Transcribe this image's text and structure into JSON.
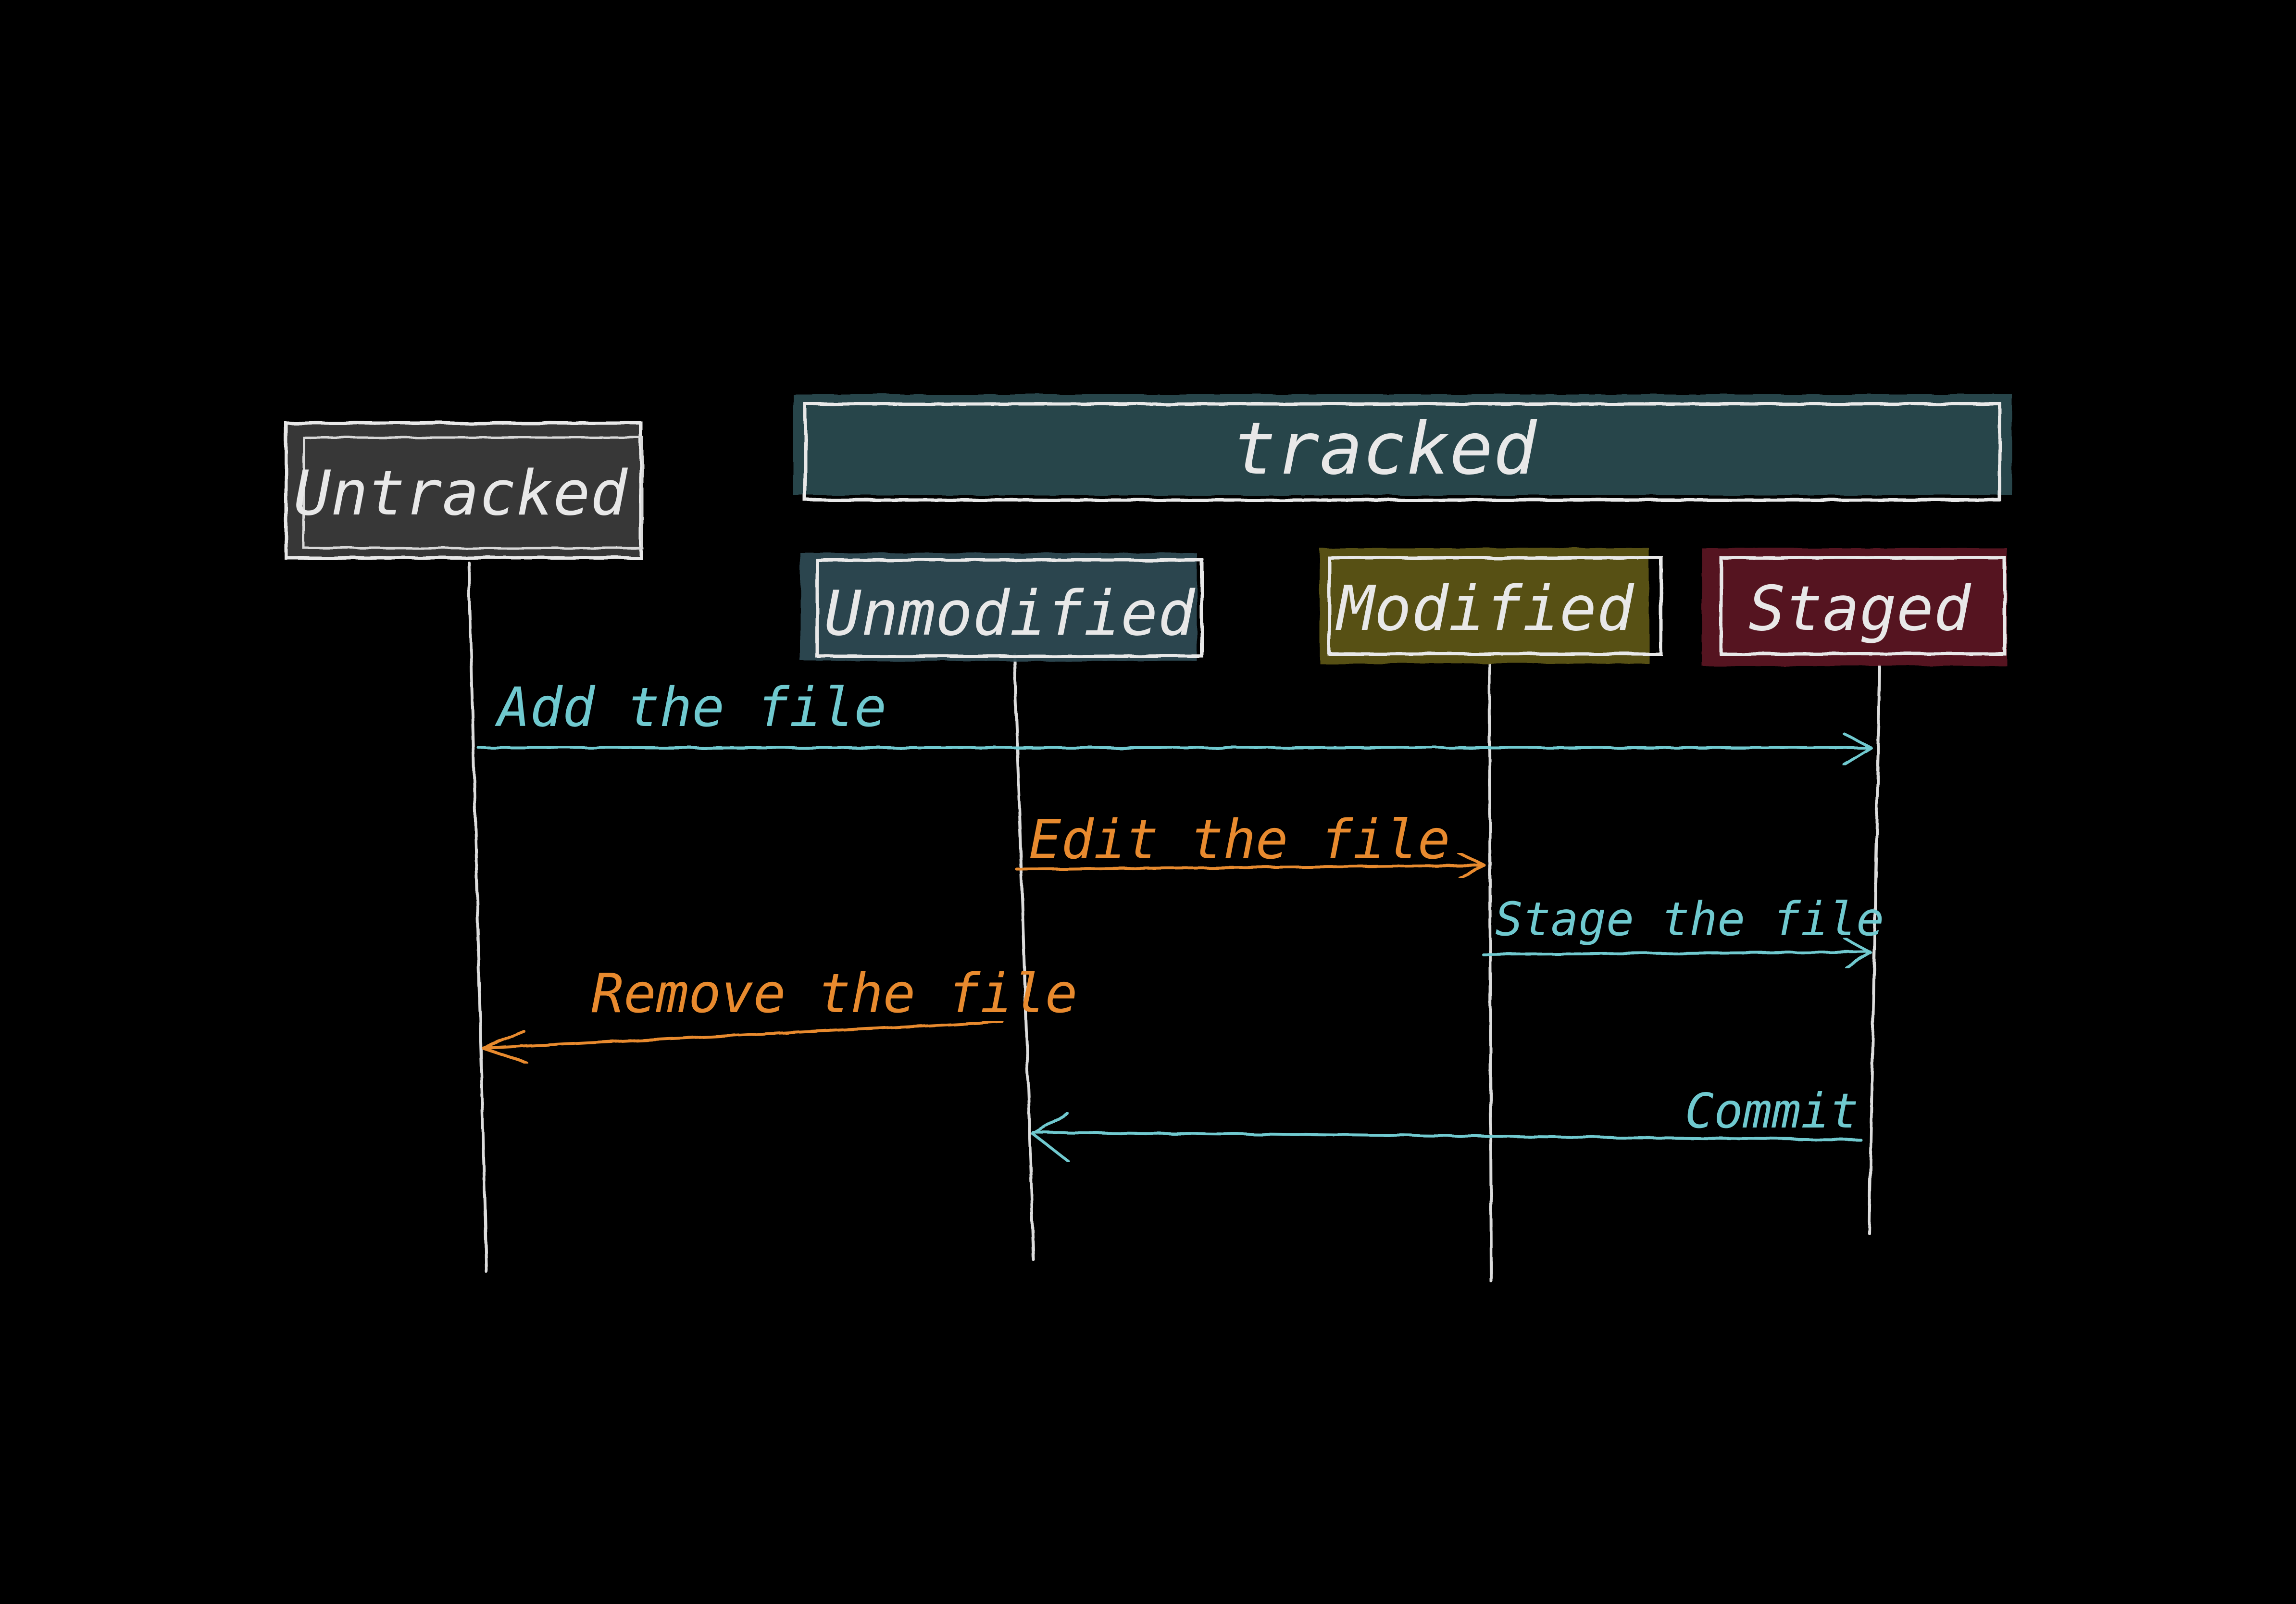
{
  "colors": {
    "background": "#000000",
    "chalk": "#e8e8e8",
    "cyan": "#6fc9cf",
    "orange": "#e88a2e",
    "tracked_fill": "#2c4a50",
    "unmodified_fill": "#2e4a52",
    "modified_fill": "#5b5418",
    "staged_fill": "#5a1420",
    "untracked_fill": "#3c3c3c"
  },
  "boxes": {
    "untracked": "Untracked",
    "tracked": "tracked",
    "unmodified": "Unmodified",
    "modified": "Modified",
    "staged": "Staged"
  },
  "arrows": {
    "add": "Add the file",
    "edit": "Edit the file",
    "stage": "Stage the file",
    "remove": "Remove the file",
    "commit": "Commit"
  }
}
